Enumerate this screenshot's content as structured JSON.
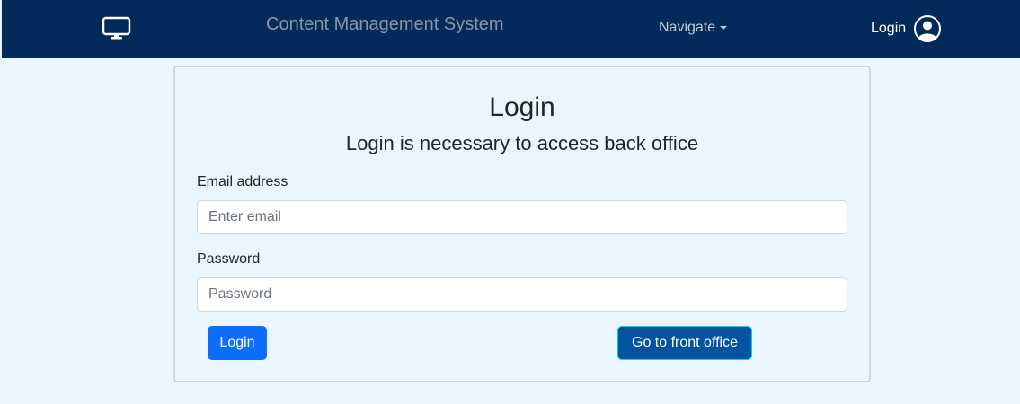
{
  "navbar": {
    "logo_icon": "monitor-icon",
    "brand": "Content Management System",
    "navigate_label": "Navigate",
    "login_label": "Login",
    "user_icon": "user-circle-icon",
    "bg_color": "#022a5a"
  },
  "card": {
    "title": "Login",
    "subtitle": "Login is necessary to access back office",
    "email": {
      "label": "Email address",
      "placeholder": "Enter email",
      "value": ""
    },
    "password": {
      "label": "Password",
      "placeholder": "Password",
      "value": ""
    },
    "login_button": "Login",
    "front_office_button": "Go to front office"
  },
  "colors": {
    "accent": "#0d6efd",
    "secondary_button": "#03539f",
    "page_bg": "#ebf5fd"
  }
}
